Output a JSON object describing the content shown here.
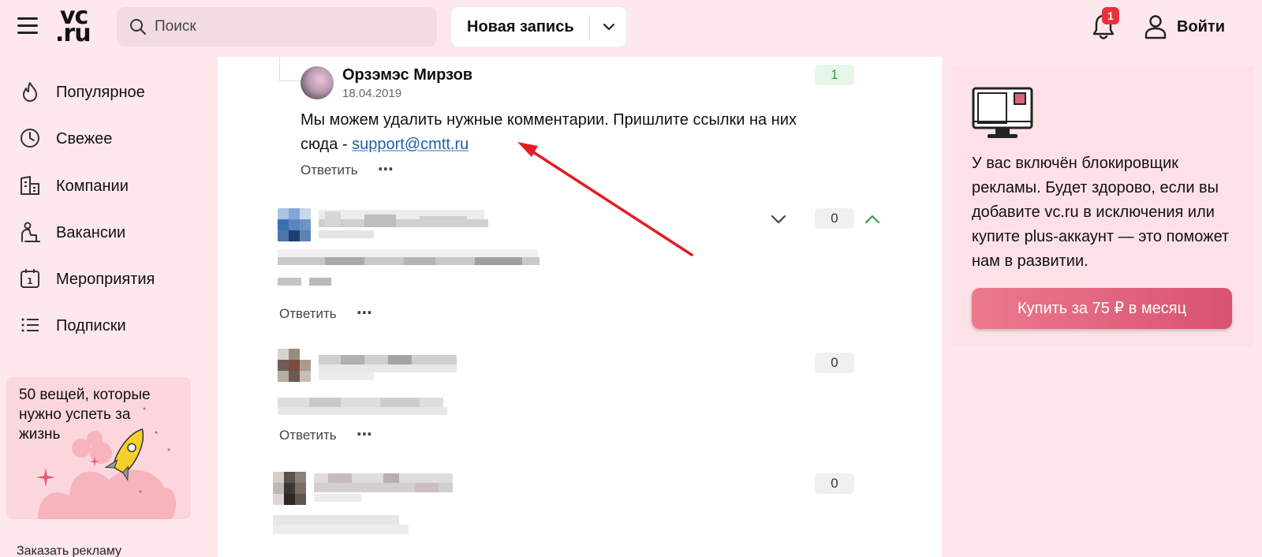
{
  "header": {
    "logo_line1": "vc",
    "logo_line2": ".ru",
    "search_placeholder": "Поиск",
    "new_post_label": "Новая запись",
    "notifications_count": "1",
    "login_label": "Войти"
  },
  "sidebar": {
    "items": [
      {
        "label": "Популярное",
        "icon": "flame-icon"
      },
      {
        "label": "Свежее",
        "icon": "clock-icon"
      },
      {
        "label": "Компании",
        "icon": "buildings-icon"
      },
      {
        "label": "Вакансии",
        "icon": "worker-icon"
      },
      {
        "label": "Мероприятия",
        "icon": "calendar-icon"
      },
      {
        "label": "Подписки",
        "icon": "list-icon"
      }
    ],
    "promo_title": "50 вещей, которые нужно успеть за жизнь",
    "order_ads": "Заказать рекламу"
  },
  "comments": [
    {
      "author": "Орзэмэс Мирзов",
      "date": "18.04.2019",
      "text_before_link": "Мы можем удалить нужные комментарии. Пришлите ссылки на них сюда - ",
      "link_text": "support@cmtt.ru",
      "score": "1",
      "reply_label": "Ответить"
    },
    {
      "score": "0",
      "reply_label": "Ответить"
    },
    {
      "score": "0",
      "reply_label": "Ответить"
    },
    {
      "score": "0"
    }
  ],
  "more_icon": "⋯",
  "colors": {
    "header_bg": "#fde8ec",
    "accent": "#d85270",
    "link": "#1f5fa8",
    "badge": "#e8313b",
    "positive": "#2fa24a",
    "annotation_arrow": "#e51c23"
  },
  "adblock": {
    "message": "У вас включён блокировщик рекламы. Будет здорово, если вы добавите vc.ru в исключения или купите plus-аккаунт — это поможет нам в развитии.",
    "button_label": "Купить за 75 ₽ в месяц"
  }
}
